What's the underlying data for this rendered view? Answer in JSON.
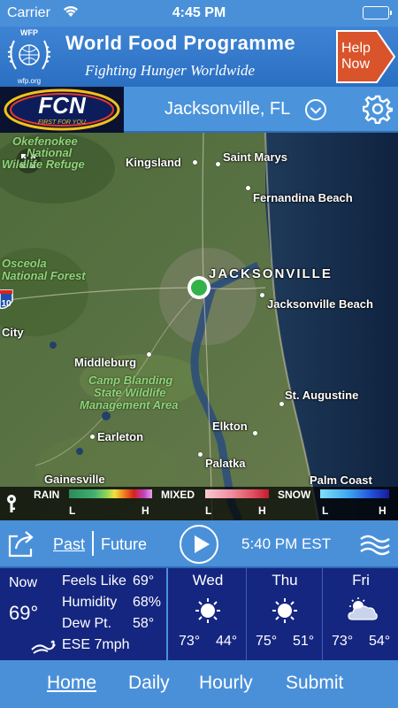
{
  "status_bar": {
    "carrier": "Carrier",
    "time": "4:45 PM"
  },
  "ad": {
    "logo_top": "WFP",
    "logo_bottom": "wfp.org",
    "title": "World Food Programme",
    "subtitle": "Fighting Hunger Worldwide",
    "cta_line1": "Help",
    "cta_line2": "Now"
  },
  "header": {
    "logo": "FCN",
    "logo_tagline": "FIRST FOR YOU",
    "location": "Jacksonville, FL"
  },
  "map": {
    "labels": {
      "okefenokee_1": "Okefenokee",
      "okefenokee_2": "National",
      "okefenokee_3": "Wildlife Refuge",
      "kingsland": "Kingsland",
      "saint_marys": "Saint Marys",
      "fernandina": "Fernandina Beach",
      "osceola_1": "Osceola",
      "osceola_2": "National Forest",
      "jacksonville": "JACKSONVILLE",
      "jax_beach": "Jacksonville Beach",
      "city": "City",
      "middleburg": "Middleburg",
      "camp_1": "Camp Blanding",
      "camp_2": "State Wildlife",
      "camp_3": "Management Area",
      "st_augustine": "St. Augustine",
      "earleton": "Earleton",
      "elkton": "Elkton",
      "palatka": "Palatka",
      "gainesville": "Gainesville",
      "palm_coast": "Palm Coast",
      "interstate": "10"
    },
    "legend": {
      "rain": "RAIN",
      "mixed": "MIXED",
      "snow": "SNOW",
      "low": "L",
      "high": "H"
    }
  },
  "playback": {
    "past": "Past",
    "future": "Future",
    "time": "5:40 PM EST"
  },
  "current": {
    "label": "Now",
    "temp": "69°",
    "feels_like_label": "Feels Like",
    "feels_like": "69°",
    "humidity_label": "Humidity",
    "humidity": "68%",
    "dew_label": "Dew Pt.",
    "dew": "58°",
    "wind": "ESE 7mph"
  },
  "forecast": [
    {
      "day": "Wed",
      "icon": "sun-icon",
      "hi": "73°",
      "lo": "44°"
    },
    {
      "day": "Thu",
      "icon": "sun-icon",
      "hi": "75°",
      "lo": "51°"
    },
    {
      "day": "Fri",
      "icon": "partly-cloudy-icon",
      "hi": "73°",
      "lo": "54°"
    }
  ],
  "nav": {
    "home": "Home",
    "daily": "Daily",
    "hourly": "Hourly",
    "submit": "Submit"
  }
}
